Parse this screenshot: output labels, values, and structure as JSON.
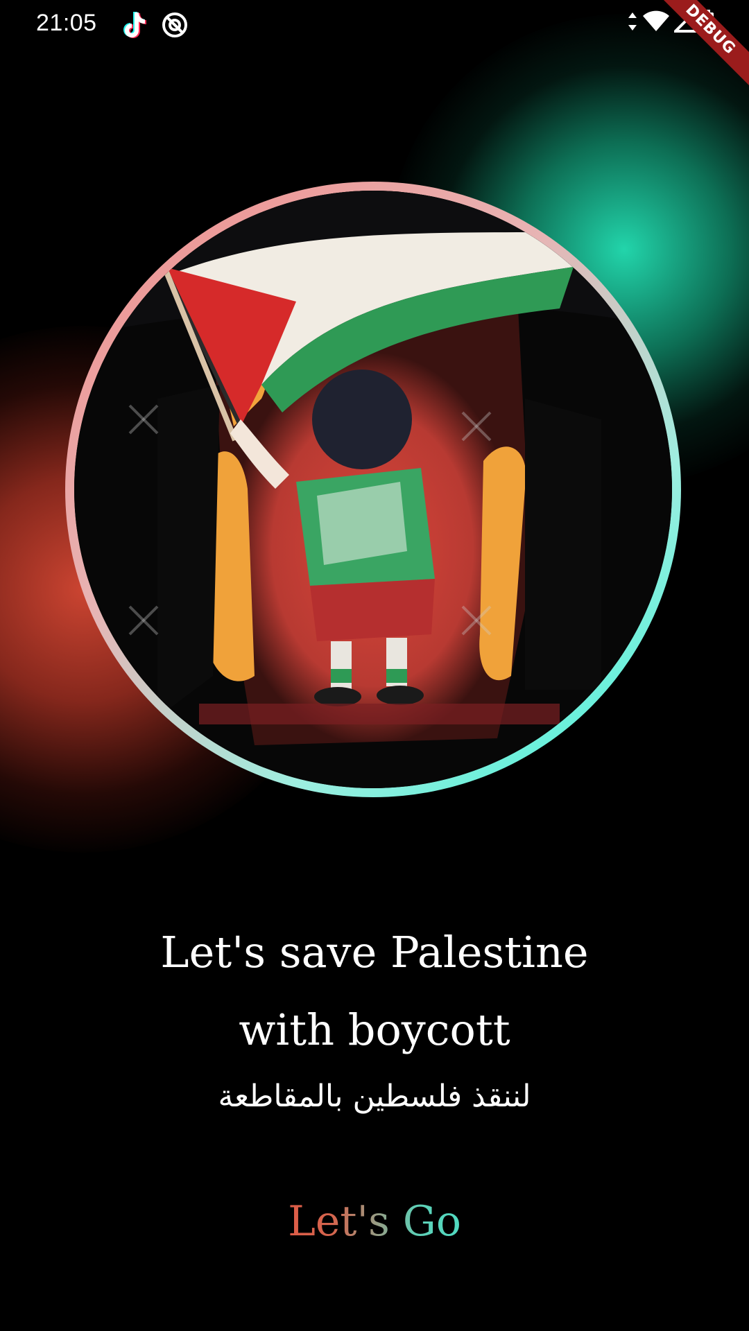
{
  "status_bar": {
    "time": "21:05",
    "left_icons": [
      "tiktok-icon",
      "at-sign-icon"
    ],
    "right_icons": [
      "data-arrows-icon",
      "wifi-icon",
      "signal-icon",
      "battery-icon"
    ],
    "debug_banner": "DEBUG"
  },
  "hero": {
    "image_icon": "palestine-child-flag-illustration",
    "ring_colors": [
      "#f08c8a",
      "#39f2d7"
    ]
  },
  "glow": {
    "left_color": "#d64834",
    "right_color": "#24e0b4"
  },
  "content": {
    "headline_line1": "Let's save Palestine",
    "headline_line2": "with boycott",
    "arabic_subtitle": "لننقذ فلسطين بالمقاطعة"
  },
  "action": {
    "go_label": "Let's Go",
    "gradient": [
      "#e6513f",
      "#3ee8cf"
    ]
  }
}
